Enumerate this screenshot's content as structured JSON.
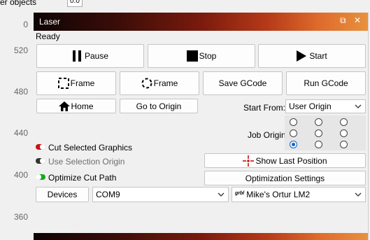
{
  "topbar": {
    "partial_label": "er objects",
    "spin_value": "0.0"
  },
  "ruler": {
    "ticks": [
      "0",
      "520",
      "480",
      "440",
      "400",
      "360"
    ]
  },
  "panel": {
    "title": "Laser",
    "status": "Ready",
    "buttons": {
      "pause": "Pause",
      "stop": "Stop",
      "start": "Start",
      "frame_rect": "Frame",
      "frame_circle": "Frame",
      "save_gcode": "Save GCode",
      "run_gcode": "Run GCode",
      "home": "Home",
      "go_to_origin": "Go to Origin",
      "show_last_position": "Show Last Position",
      "optimization_settings": "Optimization Settings",
      "devices": "Devices"
    },
    "start_from": {
      "label": "Start From:",
      "value": "User Origin"
    },
    "job_origin": {
      "label": "Job Origin",
      "selected_index": 6
    },
    "toggles": {
      "cut_selected": {
        "label": "Cut Selected Graphics",
        "on": false,
        "color": "#c81414"
      },
      "use_selection_origin": {
        "label": "Use Selection Origin",
        "on": false,
        "color": "#333333"
      },
      "optimize_cut_path": {
        "label": "Optimize Cut Path",
        "on": true,
        "color": "#19a819"
      }
    },
    "port": {
      "value": "COM9"
    },
    "device": {
      "prefix": "grbl",
      "value": "Mike's Ortur LM2"
    }
  }
}
